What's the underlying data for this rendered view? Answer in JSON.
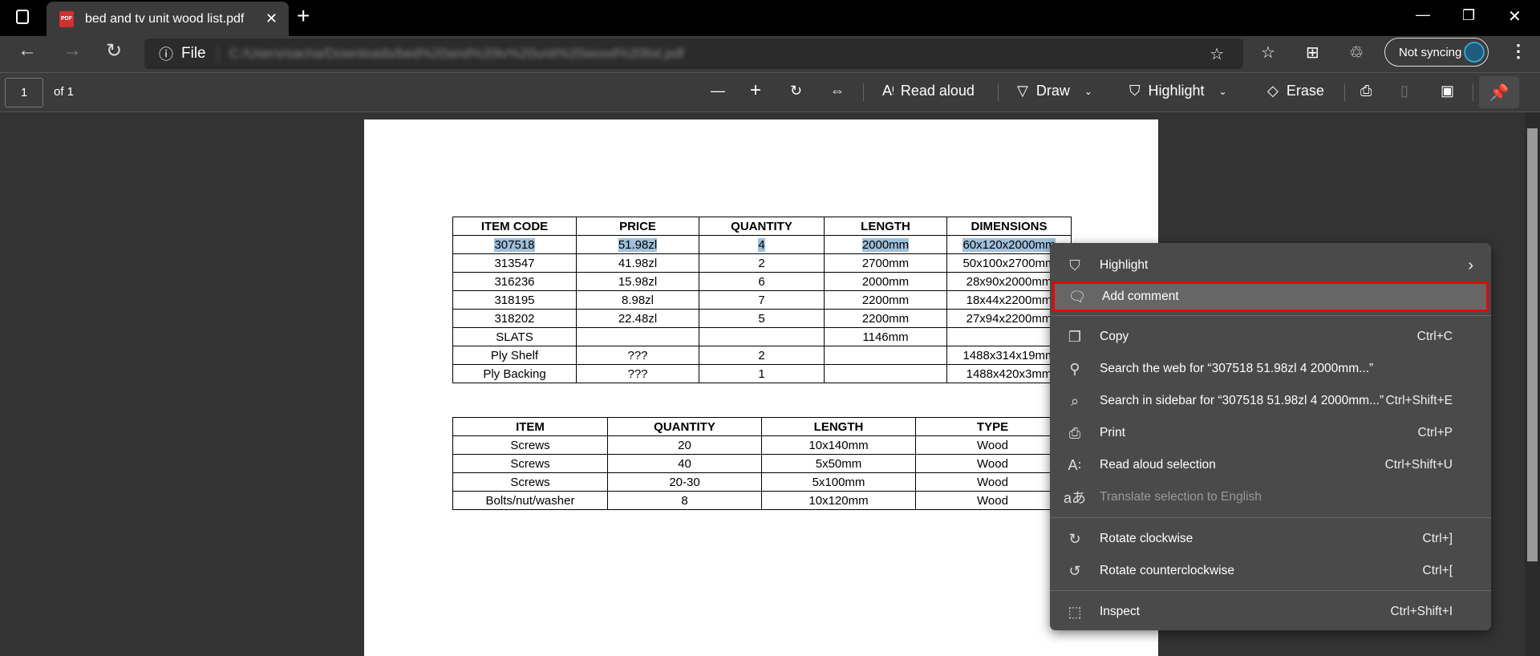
{
  "browser": {
    "tab_title": "bed and tv unit wood list.pdf",
    "address_prefix": "File",
    "address_url": "C:/Users/sacha/Downloads/bed%20and%20tv%20unit%20wood%20list.pdf",
    "sync_label": "Not syncing"
  },
  "pdf_toolbar": {
    "page_current": "1",
    "page_total": "of 1",
    "read_aloud": "Read aloud",
    "draw": "Draw",
    "highlight": "Highlight",
    "erase": "Erase"
  },
  "table1": {
    "headers": [
      "ITEM CODE",
      "PRICE",
      "QUANTITY",
      "LENGTH",
      "DIMENSIONS"
    ],
    "rows": [
      [
        "307518",
        "51.98zl",
        "4",
        "2000mm",
        "60x120x2000mm"
      ],
      [
        "313547",
        "41.98zl",
        "2",
        "2700mm",
        "50x100x2700mm"
      ],
      [
        "316236",
        "15.98zl",
        "6",
        "2000mm",
        "28x90x2000mm"
      ],
      [
        "318195",
        "8.98zl",
        "7",
        "2200mm",
        "18x44x2200mm"
      ],
      [
        "318202",
        "22.48zl",
        "5",
        "2200mm",
        "27x94x2200mm"
      ],
      [
        "SLATS",
        "",
        "",
        "1146mm",
        ""
      ],
      [
        "Ply Shelf",
        "???",
        "2",
        "",
        "1488x314x19mm"
      ],
      [
        "Ply Backing",
        "???",
        "1",
        "",
        "1488x420x3mm"
      ]
    ]
  },
  "table2": {
    "headers": [
      "ITEM",
      "QUANTITY",
      "LENGTH",
      "TYPE"
    ],
    "rows": [
      [
        "Screws",
        "20",
        "10x140mm",
        "Wood"
      ],
      [
        "Screws",
        "40",
        "5x50mm",
        "Wood"
      ],
      [
        "Screws",
        "20-30",
        "5x100mm",
        "Wood"
      ],
      [
        "Bolts/nut/washer",
        "8",
        "10x120mm",
        "Wood"
      ]
    ]
  },
  "context_menu": {
    "items": [
      {
        "label": "Highlight",
        "icon": "highlighter-icon",
        "shortcut": "",
        "submenu": true
      },
      {
        "label": "Add comment",
        "icon": "comment-icon",
        "shortcut": "",
        "highlighted": true
      },
      {
        "label": "Copy",
        "icon": "copy-icon",
        "shortcut": "Ctrl+C"
      },
      {
        "label": "Search the web for “307518 51.98zl 4 2000mm...”",
        "icon": "search-icon",
        "shortcut": ""
      },
      {
        "label": "Search in sidebar for “307518 51.98zl 4 2000mm...”",
        "icon": "sidebar-search-icon",
        "shortcut": "Ctrl+Shift+E"
      },
      {
        "label": "Print",
        "icon": "print-icon",
        "shortcut": "Ctrl+P"
      },
      {
        "label": "Read aloud selection",
        "icon": "read-aloud-icon",
        "shortcut": "Ctrl+Shift+U"
      },
      {
        "label": "Translate selection to English",
        "icon": "translate-icon",
        "shortcut": "",
        "disabled": true
      },
      {
        "label": "Rotate clockwise",
        "icon": "rotate-cw-icon",
        "shortcut": "Ctrl+]"
      },
      {
        "label": "Rotate counterclockwise",
        "icon": "rotate-ccw-icon",
        "shortcut": "Ctrl+["
      },
      {
        "label": "Inspect",
        "icon": "inspect-icon",
        "shortcut": "Ctrl+Shift+I"
      }
    ]
  },
  "colors": {
    "selection": "#9ec0dc",
    "menu_highlight_outline": "#e00000",
    "menu_bg": "#4a4a4a"
  }
}
